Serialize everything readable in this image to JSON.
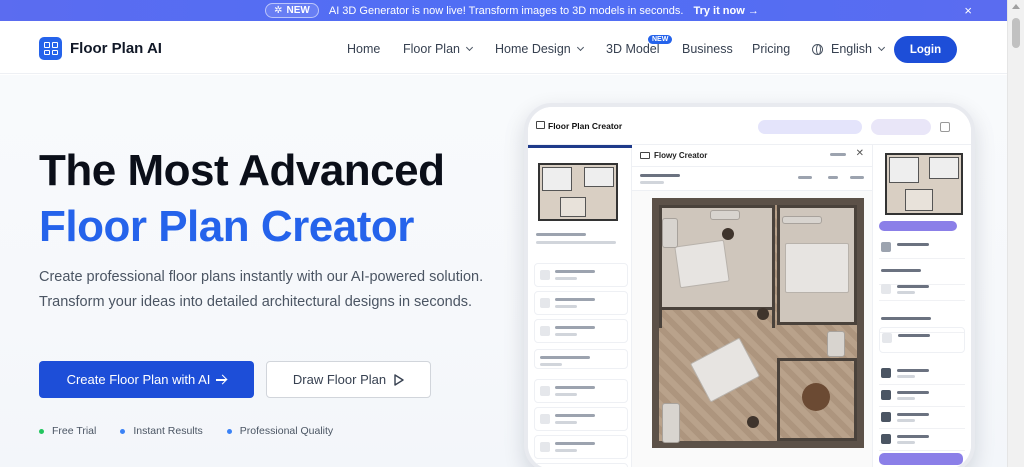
{
  "announcement": {
    "badge": "NEW",
    "message": "AI 3D Generator is now live! Transform images to 3D models in seconds.",
    "cta": "Try it now",
    "close": "×"
  },
  "nav": {
    "brand": "Floor Plan AI",
    "items": [
      {
        "label": "Home"
      },
      {
        "label": "Floor Plan"
      },
      {
        "label": "Home Design"
      },
      {
        "label": "3D Model"
      },
      {
        "label": "Business"
      },
      {
        "label": "Pricing"
      }
    ],
    "new_badge": "NEW",
    "language": "English",
    "login": "Login"
  },
  "hero": {
    "title_line1": "The Most Advanced",
    "title_line2": "Floor Plan Creator",
    "description": "Create professional floor plans instantly with our AI-powered solution. Transform your ideas into detailed architectural designs in seconds.",
    "primary_button": "Create Floor Plan with AI",
    "secondary_button": "Draw Floor Plan",
    "features": [
      {
        "label": "Free Trial",
        "color": "#22c55e"
      },
      {
        "label": "Instant Results",
        "color": "#3b82f6"
      },
      {
        "label": "Professional Quality",
        "color": "#3b82f6"
      }
    ]
  },
  "preview": {
    "app_title": "Floor Plan Creator",
    "canvas_title": "Flowy Creator"
  },
  "colors": {
    "brand": "#2563eb",
    "button": "#1d4ed8",
    "announcement": "#5b6cf0"
  }
}
